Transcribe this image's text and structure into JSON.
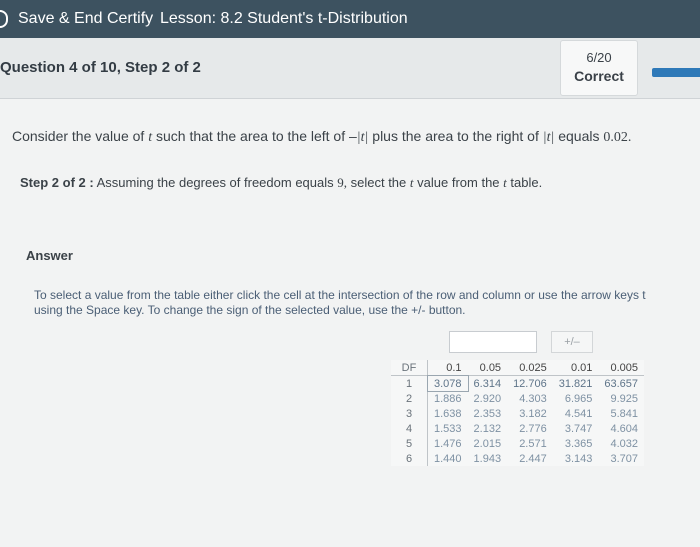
{
  "topbar": {
    "save_label": "Save & End Certify",
    "lesson_label": "Lesson: 8.2 Student's t-Distribution"
  },
  "question_header": {
    "title": "Question 4 of 10, Step 2 of 2",
    "score": "6/20",
    "status": "Correct"
  },
  "question": {
    "part1": "Consider the value of",
    "t": "t",
    "part2": "such that the area to the left of –",
    "abs_t": "|t|",
    "part3": "plus the area to the right of",
    "abs_t2": "|t|",
    "part4": "equals",
    "value": "0.02."
  },
  "step": {
    "label": "Step 2 of 2 :",
    "text1": "Assuming the degrees of freedom equals",
    "df": "9,",
    "text2": "select the",
    "t": "t",
    "text3": "value from the",
    "t2": "t",
    "text4": "table."
  },
  "answer": {
    "heading": "Answer",
    "instructions_line1": "To select a value from the table either click the cell at the intersection of the row and column or use the arrow keys t",
    "instructions_line2": "using the Space key. To change the sign of the selected value, use the +/- button.",
    "input_value": "",
    "plus_minus_label": "+/–"
  },
  "t_table": {
    "headers": [
      "DF",
      "0.1",
      "0.05",
      "0.025",
      "0.01",
      "0.005"
    ],
    "rows": [
      [
        "1",
        "3.078",
        "6.314",
        "12.706",
        "31.821",
        "63.657"
      ],
      [
        "2",
        "1.886",
        "2.920",
        "4.303",
        "6.965",
        "9.925"
      ],
      [
        "3",
        "1.638",
        "2.353",
        "3.182",
        "4.541",
        "5.841"
      ],
      [
        "4",
        "1.533",
        "2.132",
        "2.776",
        "3.747",
        "4.604"
      ],
      [
        "5",
        "1.476",
        "2.015",
        "2.571",
        "3.365",
        "4.032"
      ],
      [
        "6",
        "1.440",
        "1.943",
        "2.447",
        "3.143",
        "3.707"
      ]
    ]
  }
}
